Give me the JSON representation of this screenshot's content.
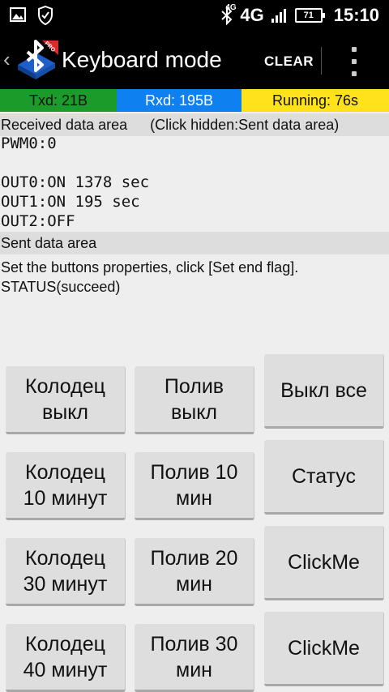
{
  "status_bar": {
    "network_sup": "4G",
    "network": "4G",
    "battery": "71",
    "time": "15:10"
  },
  "action_bar": {
    "title": "Keyboard mode",
    "clear_label": "CLEAR",
    "logo_badge": "PRO"
  },
  "counters": {
    "txd": "Txd: 21B",
    "rxd": "Rxd: 195B",
    "running": "Running: 76s"
  },
  "received": {
    "header": "Received data area",
    "hint": "(Click hidden:Sent data area)",
    "text": "PWM0:0\n\nOUT0:ON 1378 sec\nOUT1:ON 195 sec\nOUT2:OFF"
  },
  "sent": {
    "header": "Sent data area",
    "text": "Set the buttons properties, click [Set end flag].\nSTATUS(succeed)"
  },
  "buttons": [
    "Колодец\nвыкл",
    "Полив\nвыкл",
    "Выкл все",
    "Колодец\n10 минут",
    "Полив 10\nмин",
    "Статус",
    "Колодец\n30 минут",
    "Полив 20\nмин",
    "ClickMe",
    "Колодец\n40 минут",
    "Полив 30\nмин",
    "ClickMe"
  ],
  "colors": {
    "txd_bg": "#1a9b2a",
    "rxd_bg": "#0e80f0",
    "running_bg": "#ffe21c"
  }
}
